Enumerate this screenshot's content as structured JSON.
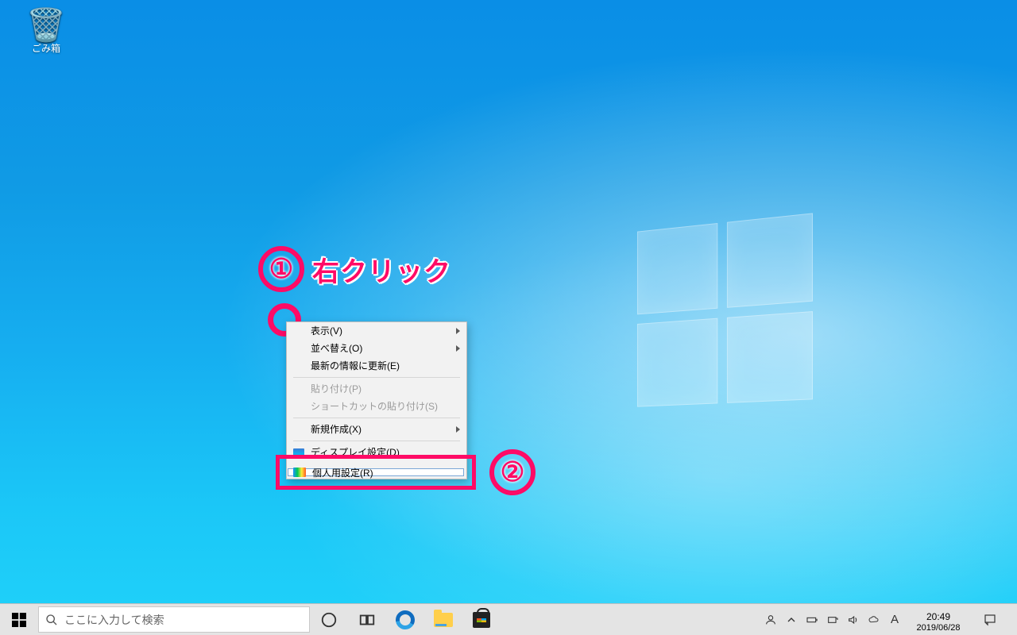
{
  "desktop": {
    "recycle_bin_label": "ごみ箱"
  },
  "annotations": {
    "step1_num": "①",
    "step1_text": "右クリック",
    "step2_num": "②"
  },
  "context_menu": {
    "view": "表示(V)",
    "sort": "並べ替え(O)",
    "refresh": "最新の情報に更新(E)",
    "paste": "貼り付け(P)",
    "paste_shortcut": "ショートカットの貼り付け(S)",
    "new": "新規作成(X)",
    "display_settings": "ディスプレイ設定(D)",
    "personalize": "個人用設定(R)"
  },
  "taskbar": {
    "search_placeholder": "ここに入力して検索",
    "ime_indicator": "A",
    "time": "20:49",
    "date": "2019/06/28"
  }
}
